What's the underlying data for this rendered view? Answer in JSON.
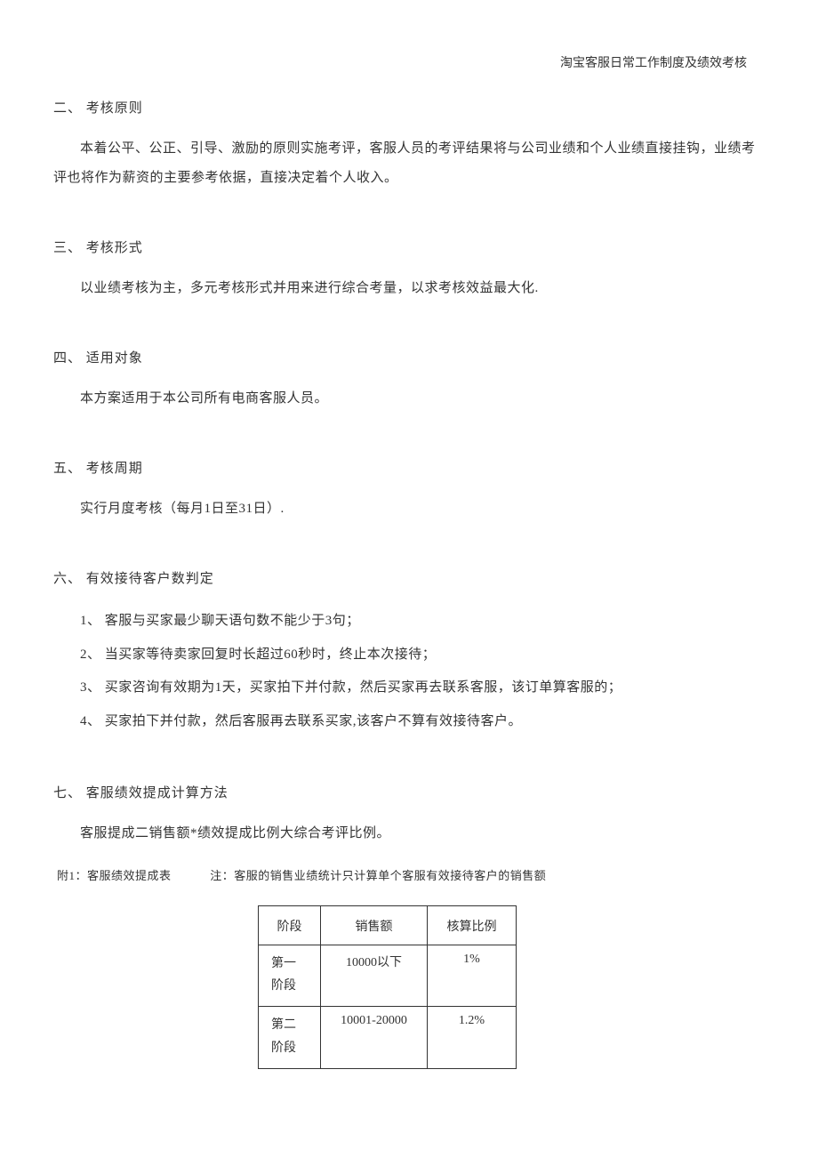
{
  "header": {
    "title": "淘宝客服日常工作制度及绩效考核"
  },
  "sections": {
    "s2": {
      "heading": "二、 考核原则",
      "paragraph": "本着公平、公正、引导、激励的原则实施考评，客服人员的考评结果将与公司业绩和个人业绩直接挂钩，业绩考评也将作为薪资的主要参考依据，直接决定着个人收入。"
    },
    "s3": {
      "heading": "三、 考核形式",
      "paragraph": "以业绩考核为主，多元考核形式并用来进行综合考量，以求考核效益最大化."
    },
    "s4": {
      "heading": "四、 适用对象",
      "paragraph": "本方案适用于本公司所有电商客服人员。"
    },
    "s5": {
      "heading": "五、 考核周期",
      "paragraph": "实行月度考核（每月1日至31日）."
    },
    "s6": {
      "heading": "六、 有效接待客户数判定",
      "items": [
        "1、 客服与买家最少聊天语句数不能少于3句；",
        "2、 当买家等待卖家回复时长超过60秒时，终止本次接待；",
        "3、 买家咨询有效期为1天，买家拍下并付款，然后买家再去联系客服，该订单算客服的；",
        "4、 买家拍下并付款，然后客服再去联系买家,该客户不算有效接待客户。"
      ]
    },
    "s7": {
      "heading": "七、 客服绩效提成计算方法",
      "paragraph": "客服提成二销售额*绩效提成比例大综合考评比例。",
      "attachment": {
        "label": "附1：客服绩效提成表",
        "note": "注：客服的销售业绩统计只计算单个客服有效接待客户的销售额"
      },
      "table": {
        "headers": [
          "阶段",
          "销售额",
          "核算比例"
        ],
        "rows": [
          {
            "stage": "第一阶段",
            "sales": "10000以下",
            "ratio": "1%"
          },
          {
            "stage": "第二阶段",
            "sales": "10001-20000",
            "ratio": "1.2%"
          }
        ]
      }
    }
  }
}
